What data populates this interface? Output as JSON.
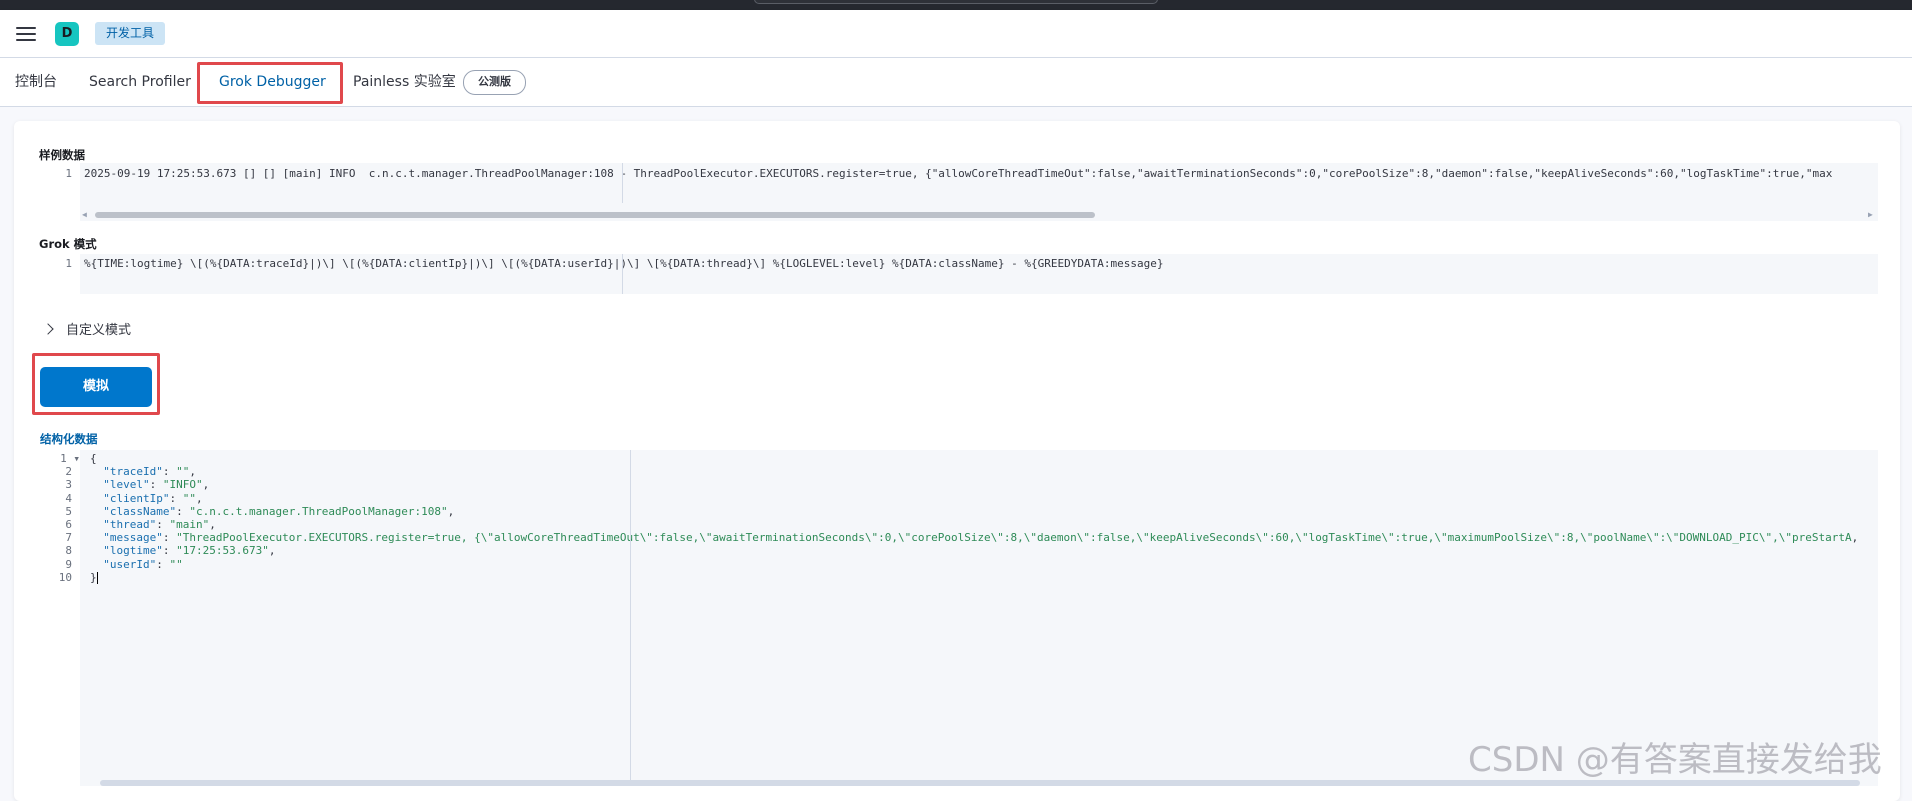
{
  "header": {
    "avatar_letter": "D",
    "breadcrumb": "开发工具"
  },
  "tabs": [
    {
      "label": "控制台"
    },
    {
      "label": "Search Profiler"
    },
    {
      "label": "Grok Debugger"
    },
    {
      "label": "Painless 实验室"
    }
  ],
  "beta_badge": "公测版",
  "sample": {
    "label": "样例数据",
    "line_number": "1",
    "text": "2025-09-19 17:25:53.673 [] [] [main] INFO  c.n.c.t.manager.ThreadPoolManager:108 - ThreadPoolExecutor.EXECUTORS.register=true, {\"allowCoreThreadTimeOut\":false,\"awaitTerminationSeconds\":0,\"corePoolSize\":8,\"daemon\":false,\"keepAliveSeconds\":60,\"logTaskTime\":true,\"max"
  },
  "grok": {
    "label": "Grok 模式",
    "line_number": "1",
    "text": "%{TIME:logtime} \\[(%{DATA:traceId}|)\\] \\[(%{DATA:clientIp}|)\\] \\[(%{DATA:userId}|)\\] \\[%{DATA:thread}\\] %{LOGLEVEL:level} %{DATA:className} - %{GREEDYDATA:message}"
  },
  "custom_patterns": {
    "label": "自定义模式"
  },
  "simulate_button": "模拟",
  "structured": {
    "label": "结构化数据",
    "line_numbers": [
      "1",
      "2",
      "3",
      "4",
      "5",
      "6",
      "7",
      "8",
      "9",
      "10"
    ],
    "lines": [
      {
        "k": "",
        "v": "{"
      },
      {
        "k": "\"traceId\"",
        "v": "\"\""
      },
      {
        "k": "\"level\"",
        "v": "\"INFO\""
      },
      {
        "k": "\"clientIp\"",
        "v": "\"\""
      },
      {
        "k": "\"className\"",
        "v": "\"c.n.c.t.manager.ThreadPoolManager:108\""
      },
      {
        "k": "\"thread\"",
        "v": "\"main\""
      },
      {
        "k": "\"message\"",
        "v": "\"ThreadPoolExecutor.EXECUTORS.register=true, {\\\"allowCoreThreadTimeOut\\\":false,\\\"awaitTerminationSeconds\\\":0,\\\"corePoolSize\\\":8,\\\"daemon\\\":false,\\\"keepAliveSeconds\\\":60,\\\"logTaskTime\\\":true,\\\"maximumPoolSize\\\":8,\\\"poolName\\\":\\\"DOWNLOAD_PIC\\\",\\\"preStartA"
      },
      {
        "k": "\"logtime\"",
        "v": "\"17:25:53.673\""
      },
      {
        "k": "\"userId\"",
        "v": "\"\""
      },
      {
        "k": "",
        "v": "}"
      }
    ]
  },
  "watermark": "CSDN @有答案直接发给我"
}
